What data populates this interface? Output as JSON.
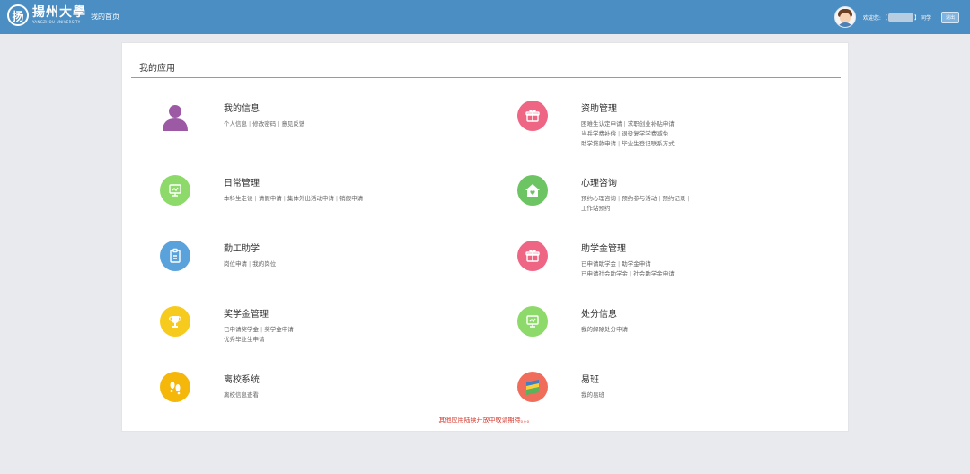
{
  "header": {
    "logo_seal": "扬",
    "logo_title": "揚州大學",
    "logo_sub": "YANGZHOU UNIVERSITY",
    "nav_home": "我的首页",
    "welcome_prefix": "欢迎您:",
    "bracket_open": "【",
    "bracket_close": "】",
    "role": "同学",
    "logout_label": "退出",
    "colors": {
      "bar": "#4a8ec4"
    }
  },
  "panel": {
    "title": "我的应用",
    "note": "其他应用陆续开放中敬请期待。。。",
    "apps": [
      {
        "name": "我的信息",
        "icon": "person-icon",
        "color": "#9b5aa3",
        "lines": [
          [
            "个人信息",
            "修改密码",
            "意见反馈"
          ]
        ]
      },
      {
        "name": "资助管理",
        "icon": "gift-icon",
        "color": "#ef6685",
        "lines": [
          [
            "困难生认定申请",
            "求职创业补贴申请"
          ],
          [
            "当兵学费补偿",
            "退役复学学费减免"
          ],
          [
            "助学贷款申请",
            "毕业生登记联系方式"
          ]
        ]
      },
      {
        "name": "日常管理",
        "icon": "monitor-icon",
        "color": "#8dd96a",
        "lines": [
          [
            "本科生走读",
            "请假申请",
            "集体外出活动申请",
            "销假申请"
          ]
        ]
      },
      {
        "name": "心理咨询",
        "icon": "house-heart-icon",
        "color": "#6cc562",
        "lines": [
          [
            "预约心理咨询",
            "预约参与活动",
            "预约记录",
            ""
          ],
          [
            "工作站预约"
          ]
        ]
      },
      {
        "name": "勤工助学",
        "icon": "document-icon",
        "color": "#5aa2dc",
        "lines": [
          [
            "岗位申请",
            "我的岗位"
          ]
        ]
      },
      {
        "name": "助学金管理",
        "icon": "gift-icon",
        "color": "#ef6685",
        "lines": [
          [
            "已申请助学金",
            "助学金申请"
          ],
          [
            "已申请社会助学金",
            "社会助学金申请"
          ]
        ]
      },
      {
        "name": "奖学金管理",
        "icon": "trophy-icon",
        "color": "#f7cb1d",
        "lines": [
          [
            "已申请奖学金",
            "奖学金申请"
          ],
          [
            "优秀毕业生申请"
          ]
        ]
      },
      {
        "name": "处分信息",
        "icon": "monitor-icon",
        "color": "#8dd96a",
        "lines": [
          [
            "我的解除处分申请"
          ]
        ]
      },
      {
        "name": "离校系统",
        "icon": "footprint-icon",
        "color": "#f5b70a",
        "lines": [
          [
            "离校信息查看"
          ]
        ]
      },
      {
        "name": "易班",
        "icon": "yiban-flag-icon",
        "color": "#f06c5b",
        "lines": [
          [
            "我的易班"
          ]
        ]
      }
    ]
  }
}
